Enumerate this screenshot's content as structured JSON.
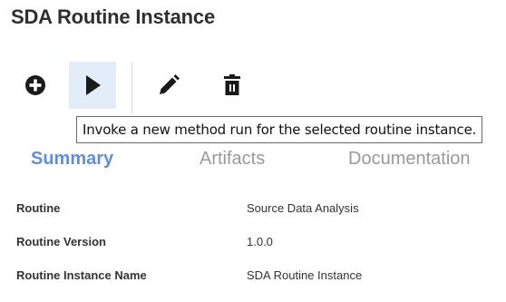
{
  "page": {
    "title": "SDA Routine Instance"
  },
  "toolbar": {
    "buttons": [
      {
        "id": "add",
        "icon": "plus-circle-icon"
      },
      {
        "id": "run",
        "icon": "play-icon"
      },
      {
        "id": "edit",
        "icon": "pencil-icon"
      },
      {
        "id": "delete",
        "icon": "trash-icon"
      }
    ],
    "tooltip": "Invoke a new method run for the selected routine instance."
  },
  "tabs": [
    {
      "label": "Summary",
      "active": true
    },
    {
      "label": "Artifacts",
      "active": false
    },
    {
      "label": "Documentation",
      "active": false
    }
  ],
  "details": [
    {
      "label": "Routine",
      "value": "Source Data Analysis"
    },
    {
      "label": "Routine Version",
      "value": "1.0.0"
    },
    {
      "label": "Routine Instance Name",
      "value": "SDA Routine Instance"
    }
  ],
  "colors": {
    "accent": "#5f8fd6",
    "selected_button_bg": "#e3ecf9",
    "icon": "#1a1a1a"
  }
}
